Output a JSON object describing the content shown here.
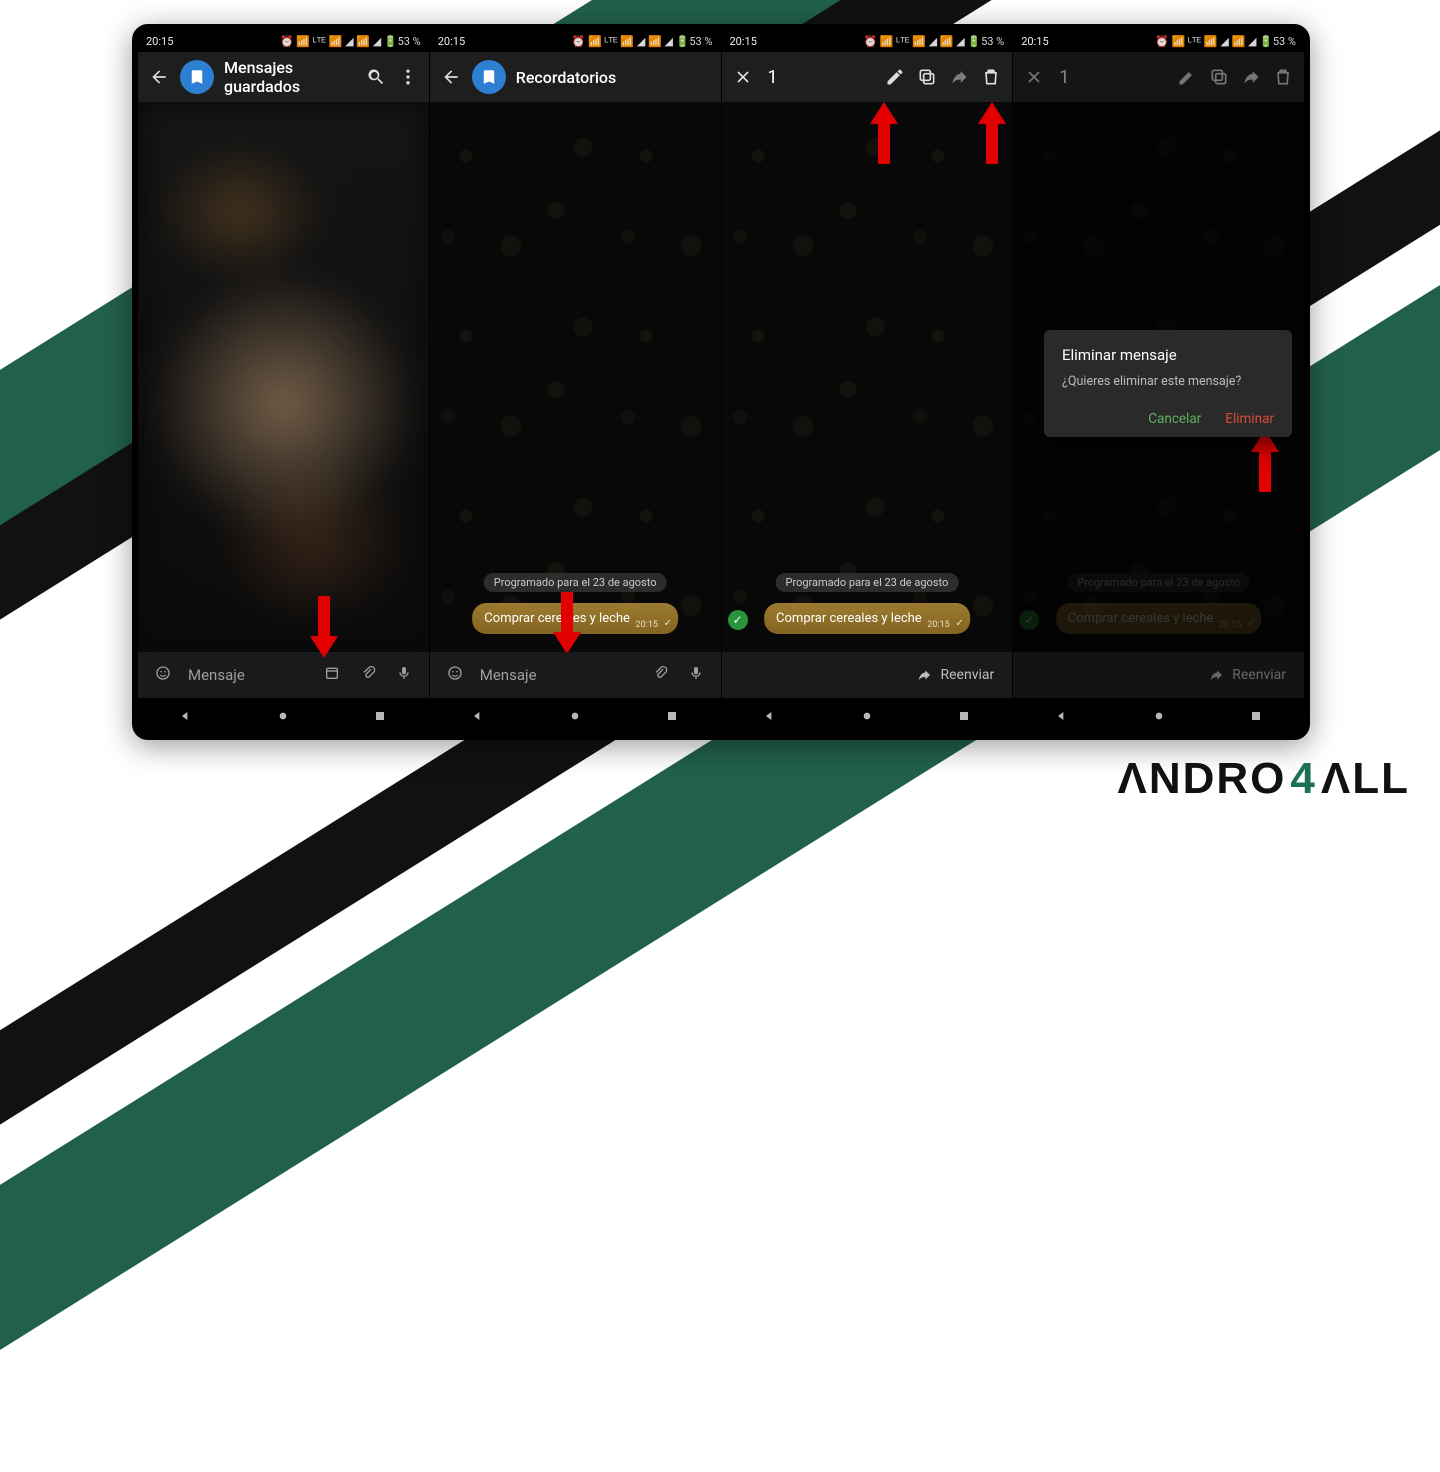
{
  "status": {
    "time": "20:15",
    "right": "⏰ 📶 ᴸᵀᴱ 📶 ◢ 📶 ◢ 🔋53 %"
  },
  "shared": {
    "scheduled_label": "Programado para el 23 de agosto",
    "bubble_text": "Comprar cereales y leche",
    "bubble_time": "20:15"
  },
  "screen1": {
    "title": "Mensajes guardados",
    "input_placeholder": "Mensaje"
  },
  "screen2": {
    "title": "Recordatorios",
    "input_placeholder": "Mensaje"
  },
  "screen3": {
    "selected_count": "1",
    "forward_label": "Reenviar"
  },
  "screen4": {
    "selected_count": "1",
    "forward_label": "Reenviar",
    "dialog": {
      "title": "Eliminar mensaje",
      "text": "¿Quieres eliminar este mensaje?",
      "cancel": "Cancelar",
      "confirm": "Eliminar"
    }
  },
  "watermark": {
    "pre": "ΛNDRO",
    "mid": "4",
    "post": "ΛLL"
  }
}
